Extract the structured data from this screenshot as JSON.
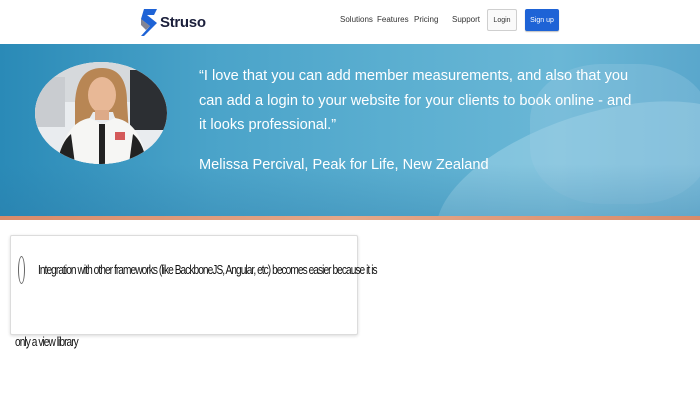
{
  "brand": {
    "name": "Struso",
    "colors": {
      "logo_blue": "#1e63d6",
      "logo_dark": "#1b1f3b"
    }
  },
  "nav": {
    "links": [
      "Solutions",
      "Features",
      "Pricing",
      "Support"
    ],
    "login_label": "Login",
    "signup_label": "Sign up",
    "signup_color": "#1e63d6"
  },
  "testimonial": {
    "quote": "“I love that you can add member measurements, and also that you can add a login to your website for your clients to book online - and it looks professional.”",
    "author": "Melissa Percival, Peak for Life, New Zealand",
    "avatar": "woman-portrait"
  },
  "feature_card": {
    "text_line_1": "Integration with other frameworks (like BackboneJS, Angular, etc) becomes easier because it is",
    "text_line_2": "only a view library"
  }
}
